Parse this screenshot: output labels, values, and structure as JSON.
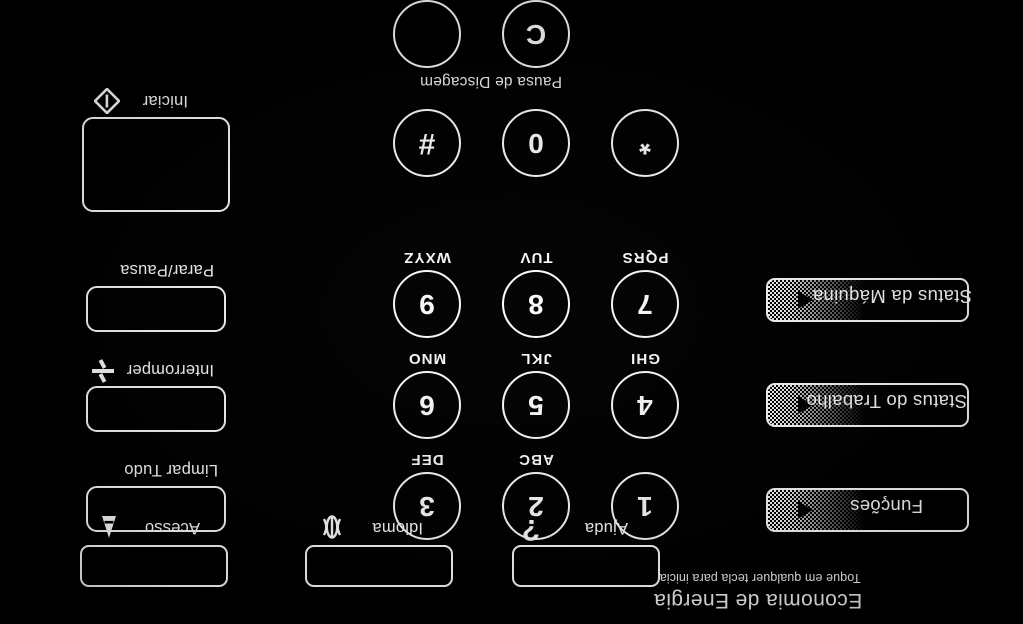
{
  "panel": {
    "background_color": "#000000",
    "foreground_color": "#ffffff",
    "orientation_note": "upside-down"
  },
  "power_save": {
    "title": "Economia de Energia",
    "subtitle": "Toque em qualquer tecla para iniciar"
  },
  "feature_keys": [
    {
      "label": "Status da Máquina",
      "icon": "triangle-left-icon"
    },
    {
      "label": "Status do Trabalho",
      "icon": "triangle-left-icon"
    },
    {
      "label": "Funções",
      "icon": "triangle-left-icon"
    }
  ],
  "keypad": {
    "dial_pause_label": "Pausa de Discagem",
    "clear_key": "C",
    "blank_key": "",
    "keys": [
      {
        "digit": "1",
        "letters": ""
      },
      {
        "digit": "2",
        "letters": "ABC"
      },
      {
        "digit": "3",
        "letters": "DEF"
      },
      {
        "digit": "4",
        "letters": "GHI"
      },
      {
        "digit": "5",
        "letters": "JKL"
      },
      {
        "digit": "6",
        "letters": "MNO"
      },
      {
        "digit": "7",
        "letters": "PQRS"
      },
      {
        "digit": "8",
        "letters": "TUV"
      },
      {
        "digit": "9",
        "letters": "WXYZ"
      },
      {
        "digit": "*",
        "letters": ""
      },
      {
        "digit": "0",
        "letters": ""
      },
      {
        "digit": "#",
        "letters": ""
      }
    ]
  },
  "command_keys": [
    {
      "label": "Iniciar",
      "icon": "start-diamond-icon"
    },
    {
      "label": "Parar/Pausa",
      "icon": ""
    },
    {
      "label": "Interromper",
      "icon": "interrupt-icon"
    },
    {
      "label": "Limpar Tudo",
      "icon": ""
    }
  ],
  "bottom_keys": [
    {
      "label": "Ajuda",
      "icon": "question-mark-icon"
    },
    {
      "label": "Idioma",
      "icon": "globe-icon"
    },
    {
      "label": "Acesso",
      "icon": "key-icon"
    }
  ]
}
